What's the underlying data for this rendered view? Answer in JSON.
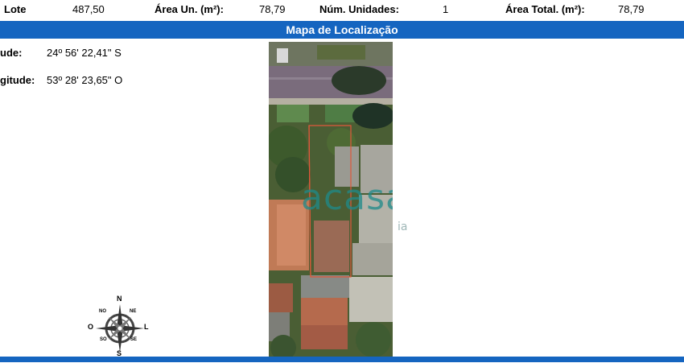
{
  "summary": {
    "lote_label": "Lote",
    "lote_value": "487,50",
    "area_un_label": "Área Un. (m²):",
    "area_un_value": "78,79",
    "num_unidades_label": "Núm. Unidades:",
    "num_unidades_value": "1",
    "area_total_label": "Área Total. (m²):",
    "area_total_value": "78,79"
  },
  "map_section": {
    "title": "Mapa de Localização",
    "latitude_label": "ude:",
    "latitude_value": "24º 56' 22,41\" S",
    "longitude_label": "gitude:",
    "longitude_value": "53º 28' 23,65\" O"
  },
  "watermark": {
    "brand": "acasa",
    "sub": "ia"
  },
  "compass": {
    "n": "N",
    "s": "S",
    "o": "O",
    "l": "L",
    "no": "NO",
    "ne": "NE",
    "so": "SO",
    "se": "SE"
  },
  "colors": {
    "bar": "#1565c0",
    "watermark": "#1e8a8a"
  }
}
